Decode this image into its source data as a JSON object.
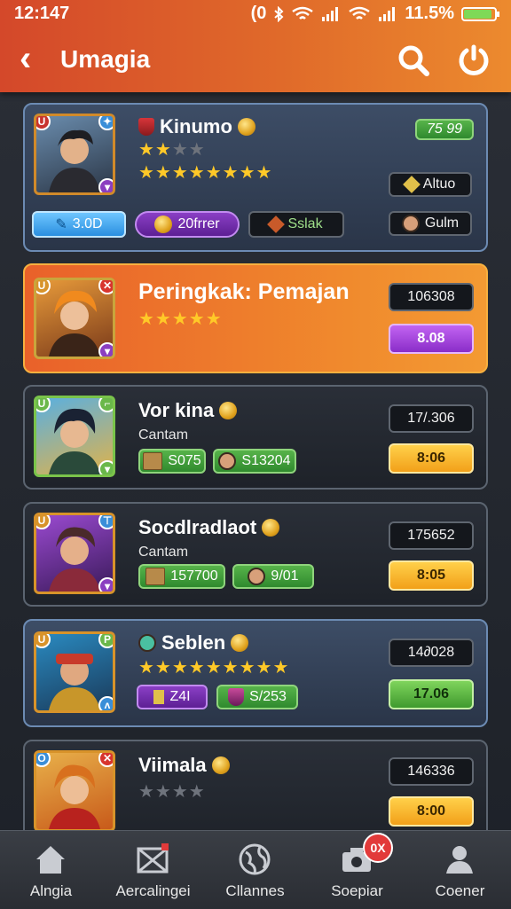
{
  "status": {
    "time": "12:147",
    "battery_text": "11.5%",
    "battery_level": 0.9,
    "signal_text": "(0"
  },
  "header": {
    "title": "Umagia",
    "back_icon": "back-arrow-icon",
    "search_icon": "search-icon",
    "power_icon": "power-icon"
  },
  "colors": {
    "header_start": "#d4482a",
    "header_end": "#ec8a2e",
    "star": "#ffc928"
  },
  "cards": [
    {
      "name": "Kinumo",
      "rating": 2,
      "stars_total": 4,
      "rating2": 8,
      "stars2_total": 8,
      "score": "75 99",
      "chips": [
        {
          "label": "3.0D",
          "style": "blue"
        },
        {
          "label": "20frrer",
          "style": "purple"
        },
        {
          "label": "Sslak",
          "style": "dark"
        }
      ],
      "side": [
        {
          "label": "Altuo"
        },
        {
          "label": "Gulm"
        }
      ]
    },
    {
      "name": "Peringkak: Pemajan",
      "rating": 5,
      "stars_total": 5,
      "score": "106308",
      "action": "8.08"
    },
    {
      "name": "Vor kina",
      "subtitle": "Cantam",
      "score": "17/.306",
      "action": "8:06",
      "chips": [
        {
          "label": "S075"
        },
        {
          "label": "S13204"
        }
      ]
    },
    {
      "name": "Socdlradlaot",
      "subtitle": "Cantam",
      "score": "175652",
      "action": "8:05",
      "chips": [
        {
          "label": "157700"
        },
        {
          "label": "9/01"
        }
      ]
    },
    {
      "name": "Seblen",
      "rating": 9,
      "stars_total": 9,
      "score": "14∂028",
      "action": "17.06",
      "chips": [
        {
          "label": "Z4I"
        },
        {
          "label": "S/253"
        }
      ]
    },
    {
      "name": "Viimala",
      "rating": 0,
      "stars_total": 4,
      "score": "146336",
      "action": "8:00"
    }
  ],
  "nav": [
    {
      "label": "Alngia",
      "icon": "home-icon"
    },
    {
      "label": "Aercalingei",
      "icon": "flag-icon"
    },
    {
      "label": "Cllannes",
      "icon": "globe-icon"
    },
    {
      "label": "Soepiar",
      "icon": "camera-icon",
      "badge": "0X"
    },
    {
      "label": "Coener",
      "icon": "user-icon"
    }
  ]
}
